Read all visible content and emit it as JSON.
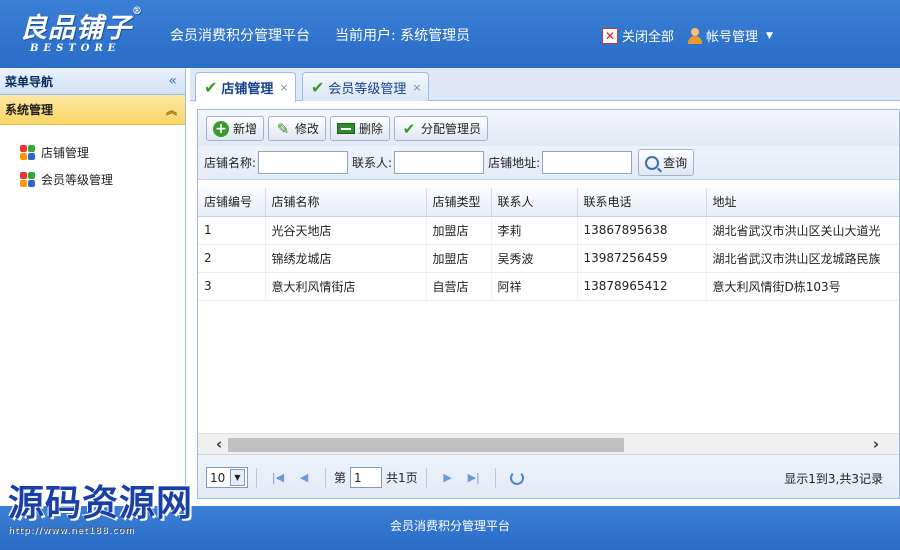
{
  "header": {
    "logo_text": "良品铺子",
    "logo_reg": "®",
    "logo_sub": "BESTORE",
    "platform_title": "会员消费积分管理平台",
    "current_user": "当前用户: 系统管理员",
    "close_all": "关闭全部",
    "account": "帐号管理",
    "accent_color": "#2a6cc6"
  },
  "sidebar": {
    "title": "菜单导航",
    "collapse_icon": "«",
    "group": "系统管理",
    "group_icon": "︽",
    "items": [
      {
        "label": "店铺管理"
      },
      {
        "label": "会员等级管理"
      }
    ]
  },
  "tabs": [
    {
      "label": "店铺管理",
      "close": "×"
    },
    {
      "label": "会员等级管理",
      "close": "×"
    }
  ],
  "toolbar": {
    "add": "新增",
    "edit": "修改",
    "delete": "删除",
    "assign": "分配管理员"
  },
  "search": {
    "store_name_label": "店铺名称:",
    "contact_label": "联系人:",
    "address_label": "店铺地址:",
    "query": "查询"
  },
  "table": {
    "columns": [
      "店铺编号",
      "店铺名称",
      "店铺类型",
      "联系人",
      "联系电话",
      "地址"
    ],
    "rows": [
      [
        "1",
        "光谷天地店",
        "加盟店",
        "李莉",
        "13867895638",
        "湖北省武汉市洪山区关山大道光"
      ],
      [
        "2",
        "锦绣龙城店",
        "加盟店",
        "吴秀波",
        "13987256459",
        "湖北省武汉市洪山区龙城路民族"
      ],
      [
        "3",
        "意大利风情街店",
        "自营店",
        "阿祥",
        "13878965412",
        "意大利风情街D栋103号"
      ]
    ]
  },
  "pager": {
    "page_size": "10",
    "page_label_before": "第",
    "page_value": "1",
    "page_label_after": "共1页",
    "info": "显示1到3,共3记录"
  },
  "footer": {
    "text": "会员消费积分管理平台"
  },
  "watermark": {
    "main": "源码资源网",
    "url": "http://www.net188.com"
  }
}
